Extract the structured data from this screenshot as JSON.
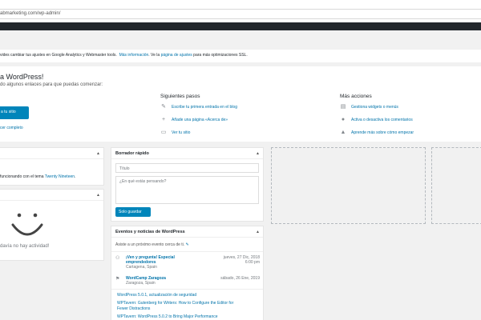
{
  "browser": {
    "url": "abmarketing.com/wp-admin/"
  },
  "notice": {
    "text": "vides cambiar tus ajustes en Google Analytics y Webmaster tools.",
    "link1": "Más información",
    "mid": ". Ve la",
    "link2": "página de ajustes",
    "end": "para más optimizaciones SSL."
  },
  "welcome": {
    "title": "a WordPress!",
    "subtitle": "do algunos enlaces para que puedas comenzar:",
    "button_label": "a tu sitio",
    "customize_link": "cer completo",
    "next_steps": {
      "heading": "Siguientes pasos",
      "items": [
        "Escribe tu primera entrada en el blog",
        "Añade una página «Acerca de»",
        "Ver tu sitio"
      ]
    },
    "more_actions": {
      "heading": "Más acciones",
      "items": [
        "Gestiona widgets o menús",
        "Activa o desactiva los comentarios",
        "Aprende más sobre cómo empezar"
      ]
    }
  },
  "glance": {
    "text_prefix": "funcionando con el tema",
    "theme_link": "Twenty Nineteen",
    "text_suffix": "."
  },
  "activity": {
    "empty_text": "davía no hay actividad!"
  },
  "quick_draft": {
    "title": "Borrador rápido",
    "title_placeholder": "Título",
    "content_placeholder": "¿En qué estás pensando?",
    "save_label": "Solo guardar"
  },
  "events": {
    "title": "Eventos y noticias de WordPress",
    "intro": "Asiste a un próximo evento cerca de ti.",
    "items": [
      {
        "title_line1": "¡Ven y pregunta! Especial",
        "title_line2": "emprendedores",
        "location": "Cartagena, Spain",
        "date": "jueves, 27 Dic, 2018",
        "time": "6:00 pm"
      },
      {
        "title_line1": "WordCamp Zaragoza",
        "title_line2": "",
        "location": "Zaragoza, Spain",
        "date": "sábado, 26 Ene, 2019",
        "time": ""
      }
    ],
    "news": [
      "WordPress 5.0.1, actualización de seguridad",
      "WPTavern: Gutenberg for Writers: How to Configure the Editor for",
      "Fewer Distractions",
      "WPTavern: WordPress 5.0.2 to Bring Major Performance"
    ]
  }
}
